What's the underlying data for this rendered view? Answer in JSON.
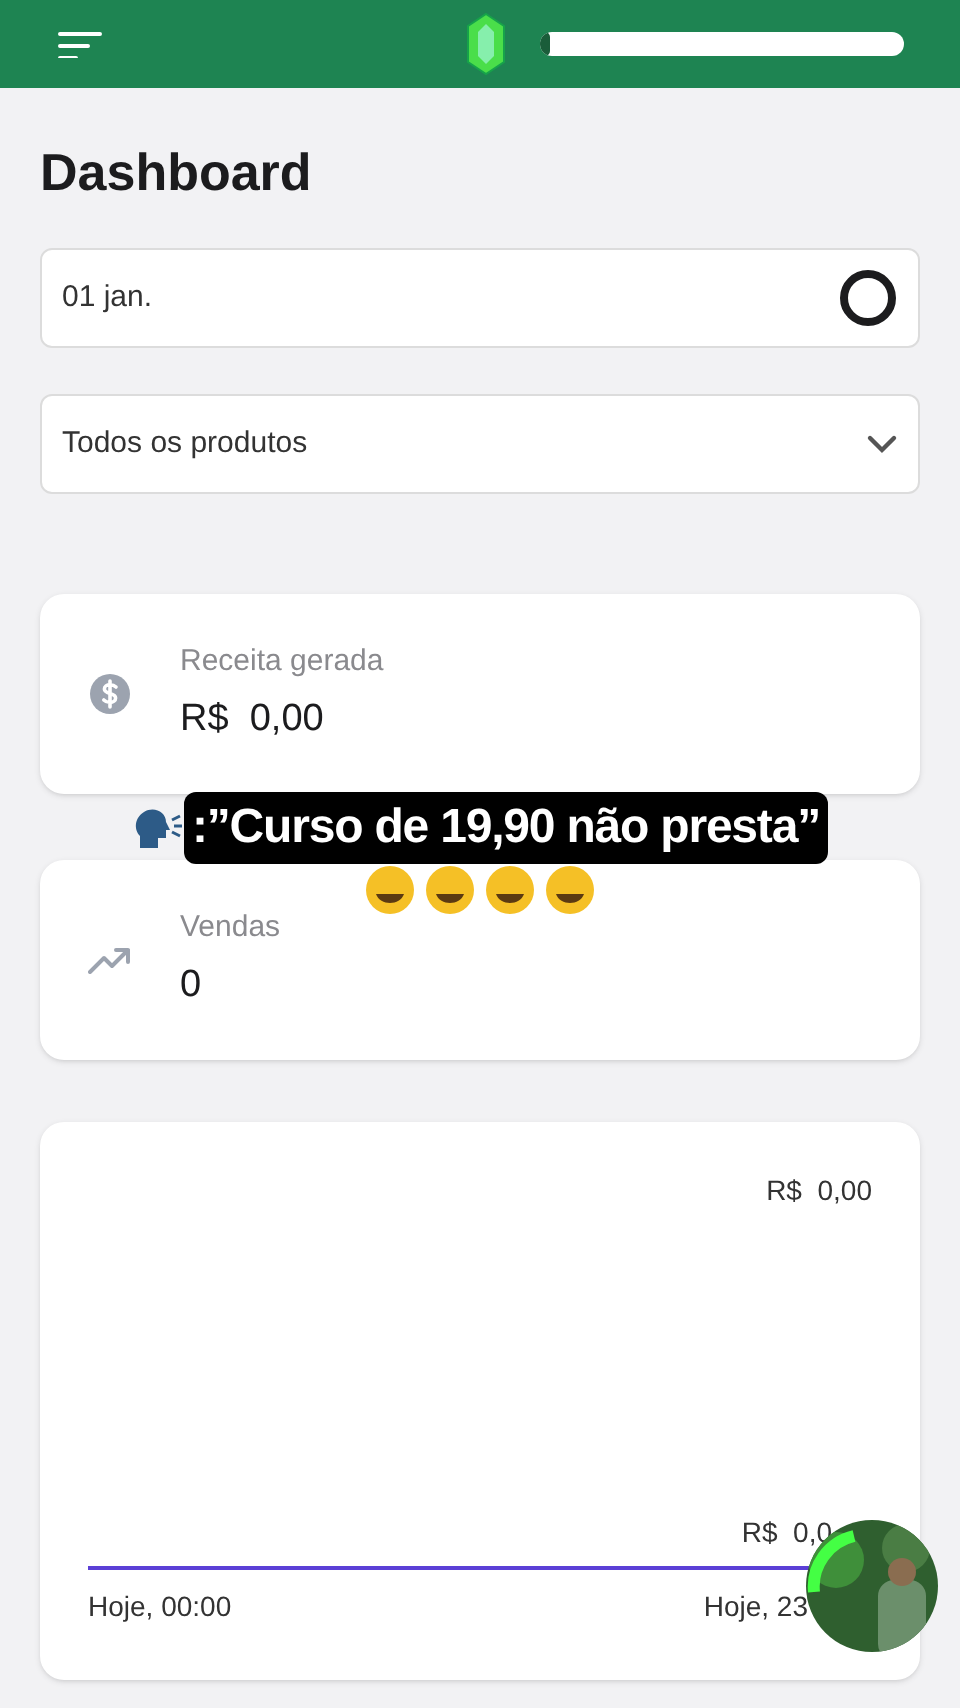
{
  "header": {
    "progress": {
      "level": 0.03
    }
  },
  "title": "Dashboard",
  "date_field": {
    "value": "01 jan."
  },
  "product_select": {
    "value": "Todos os produtos"
  },
  "stats": [
    {
      "kind": "money",
      "label": "Receita gerada",
      "value": "R$  0,00"
    },
    {
      "kind": "trend",
      "label": "Vendas",
      "value": "0"
    }
  ],
  "chart": {
    "y_top": "R$  0,00",
    "y_bottom": "R$  0,0",
    "x_start": "Hoje, 00:00",
    "x_end": "Hoje, 23"
  },
  "caption": {
    "text": ":”Curso de 19,90 não presta”",
    "emojis": [
      {
        "kind": "laughing"
      },
      {
        "kind": "laughing"
      },
      {
        "kind": "laughing"
      },
      {
        "kind": "laughing"
      }
    ]
  }
}
